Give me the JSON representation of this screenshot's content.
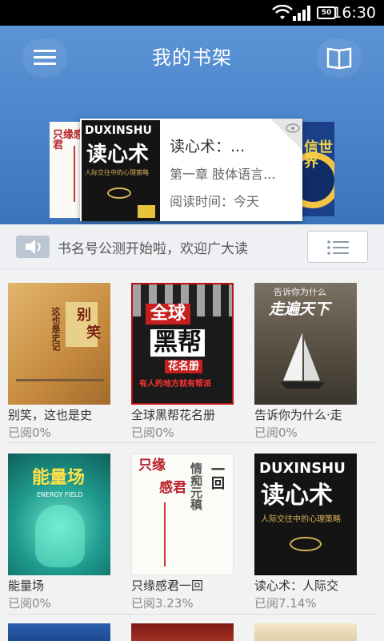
{
  "status_bar": {
    "time": "16:30",
    "battery": "50"
  },
  "header": {
    "title": "我的书架"
  },
  "featured": {
    "title": "读心术：...",
    "chapter": "第一章  肢体语言...",
    "read_time": "阅读时间：今天",
    "cover_text": {
      "brand": "DUXINSHU",
      "title": "读心术",
      "subtitle": "人际交往中的心理策略"
    },
    "left_cover_text": "只缘感君",
    "right_cover_text": "信世界"
  },
  "carousel": {
    "count": 3,
    "active": 1
  },
  "notice": {
    "text": "书名号公测开始啦，欢迎广大读"
  },
  "books": [
    {
      "title": "别笑，这也是史",
      "progress": "已阅0%",
      "cover": {
        "lines": [
          "别",
          "笑",
          "这也是史记"
        ],
        "bg": "#cf9a4e"
      }
    },
    {
      "title": "全球黑帮花名册",
      "progress": "已阅0%",
      "cover": {
        "lines": [
          "全球",
          "黑帮",
          "花名册",
          "有人的地方就有帮派"
        ],
        "bg": "#1a1a1a"
      }
    },
    {
      "title": "告诉你为什么·走",
      "progress": "已阅0%",
      "cover": {
        "lines": [
          "告诉你为什么",
          "走遍天下"
        ],
        "bg": "#5b5348"
      }
    },
    {
      "title": "能量场",
      "progress": "已阅0%",
      "cover": {
        "lines": [
          "能量场",
          "ENERGY FIELD"
        ],
        "bg": "#1f9b8e"
      }
    },
    {
      "title": "只缘感君一回",
      "progress": "已阅3.23%",
      "cover": {
        "lines": [
          "只缘",
          "感君",
          "一回",
          "情痴元稹"
        ],
        "bg": "#fbfbf8"
      }
    },
    {
      "title": "读心术：人际交",
      "progress": "已阅7.14%",
      "cover": {
        "lines": [
          "DUXINSHU",
          "读心术",
          "人际交往中的心理策略"
        ],
        "bg": "#1a1a1a"
      }
    }
  ],
  "colors": {
    "accent": "#4a83c8",
    "notice_bg": "#eef0f3"
  }
}
